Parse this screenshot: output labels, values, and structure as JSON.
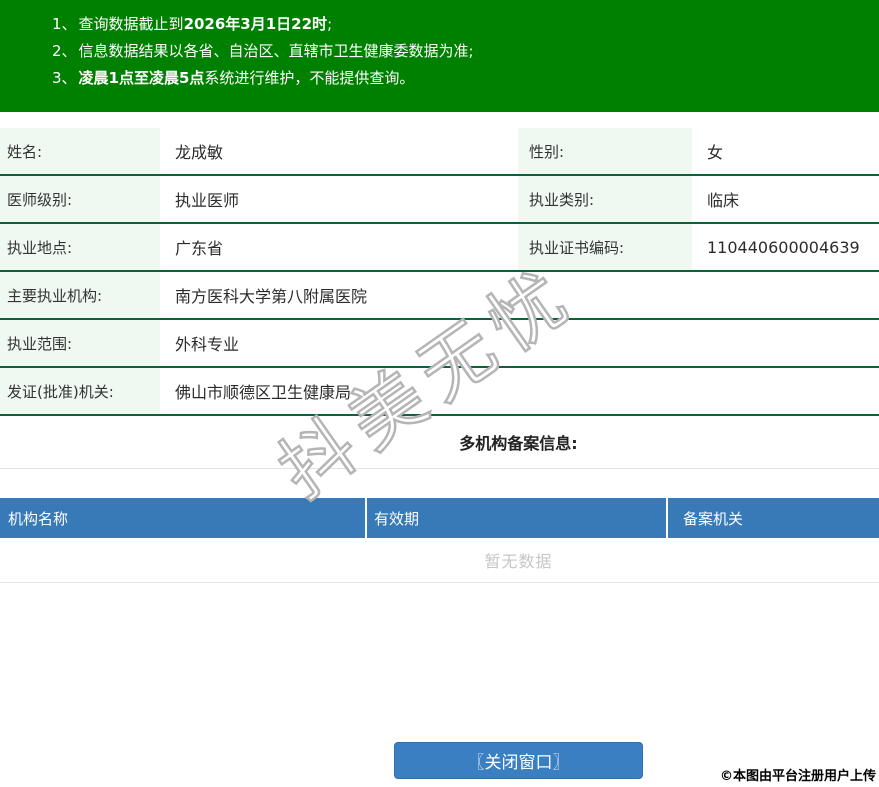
{
  "colors": {
    "header_green": "#008000",
    "row_border_green": "#11603a",
    "label_bg": "#eff9f2",
    "table_header_blue": "#3879b7",
    "button_blue": "#3a7fc1",
    "empty_text_grey": "#c6c6cb"
  },
  "notice_banner": {
    "items": [
      {
        "number": "1、",
        "pre": "查询数据截止到",
        "bold": "2026年3月1日22时",
        "post": ";"
      },
      {
        "number": "2、",
        "pre": "信息数据结果以各省、自治区、直辖市卫生健康委数据为准;"
      },
      {
        "number": "3、",
        "bold": "凌晨1点至凌晨5点",
        "post": "系统进行维护，不能提供查询。"
      }
    ]
  },
  "info": {
    "rows": [
      {
        "left_label": "姓名:",
        "left_value": "龙成敏",
        "right_label": "性别:",
        "right_value": "女"
      },
      {
        "left_label": "医师级别:",
        "left_value": "执业医师",
        "right_label": "执业类别:",
        "right_value": "临床"
      },
      {
        "left_label": "执业地点:",
        "left_value": "广东省",
        "right_label": "执业证书编码:",
        "right_value": "110440600004639"
      },
      {
        "label": "主要执业机构:",
        "value": "南方医科大学第八附属医院"
      },
      {
        "label": "执业范围:",
        "value": "外科专业"
      },
      {
        "label": "发证(批准)机关:",
        "value": "佛山市顺德区卫生健康局"
      }
    ]
  },
  "section": {
    "title": "多机构备案信息:"
  },
  "filing_table": {
    "columns": [
      "机构名称",
      "有效期",
      "备案机关"
    ],
    "empty_text": "暂无数据"
  },
  "actions": {
    "close_button": "〖关闭窗口〗"
  },
  "watermark": {
    "text": "抖美无忧"
  },
  "footer": {
    "credit": "©本图由平台注册用户上传"
  }
}
